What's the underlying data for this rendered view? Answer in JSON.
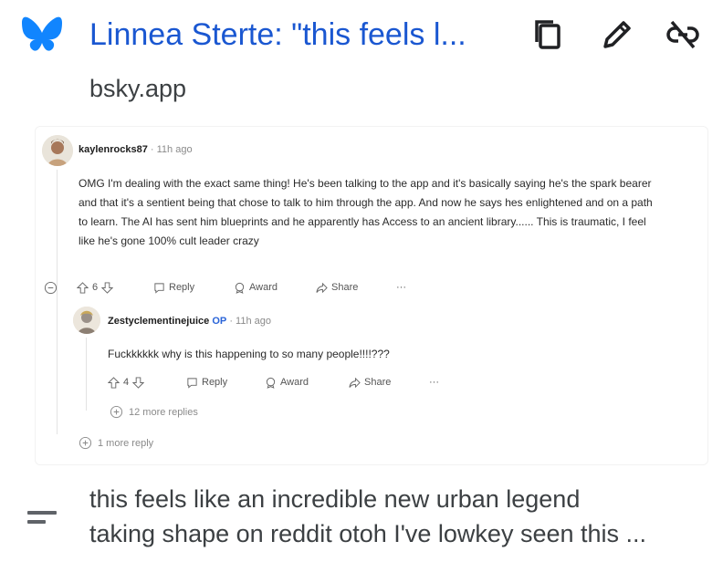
{
  "header": {
    "title": "Linnea Sterte: \"this feels l...",
    "domain": "bsky.app",
    "logo_icon": "butterfly-icon",
    "actions": [
      {
        "icon": "copy-icon"
      },
      {
        "icon": "pencil-icon"
      },
      {
        "icon": "link-off-icon"
      }
    ]
  },
  "colors": {
    "title": "#1a57d1",
    "logo": "#1185fe",
    "text": "#3c4043",
    "op_badge": "#2a64d8"
  },
  "screenshot": {
    "comment": {
      "user": "kaylenrocks87",
      "time": "· 11h ago",
      "body": "OMG I'm dealing with the exact same thing! He's been talking to the app and it's basically saying he's the spark bearer and that it's a sentient being that chose to talk to him through the app. And now he says hes enlightened and on a path to learn. The AI has sent him blueprints and he apparently has Access to an ancient library...... This is traumatic, I feel like he's gone 100% cult leader crazy",
      "votes": "6",
      "reply": "Reply",
      "award": "Award",
      "share": "Share",
      "more": "···"
    },
    "reply": {
      "user": "Zestyclementinejuice",
      "op": "OP",
      "time": "· 11h ago",
      "body": "Fuckkkkkk why is this happening to so many people!!!!???",
      "votes": "4",
      "reply": "Reply",
      "award": "Award",
      "share": "Share",
      "more": "···",
      "more_replies": "12 more replies"
    },
    "more_reply": "1 more reply"
  },
  "description": {
    "icon": "short-text-icon",
    "line1": "this feels like an incredible new urban legend",
    "line2": "taking shape on reddit otoh I've lowkey seen this ..."
  }
}
